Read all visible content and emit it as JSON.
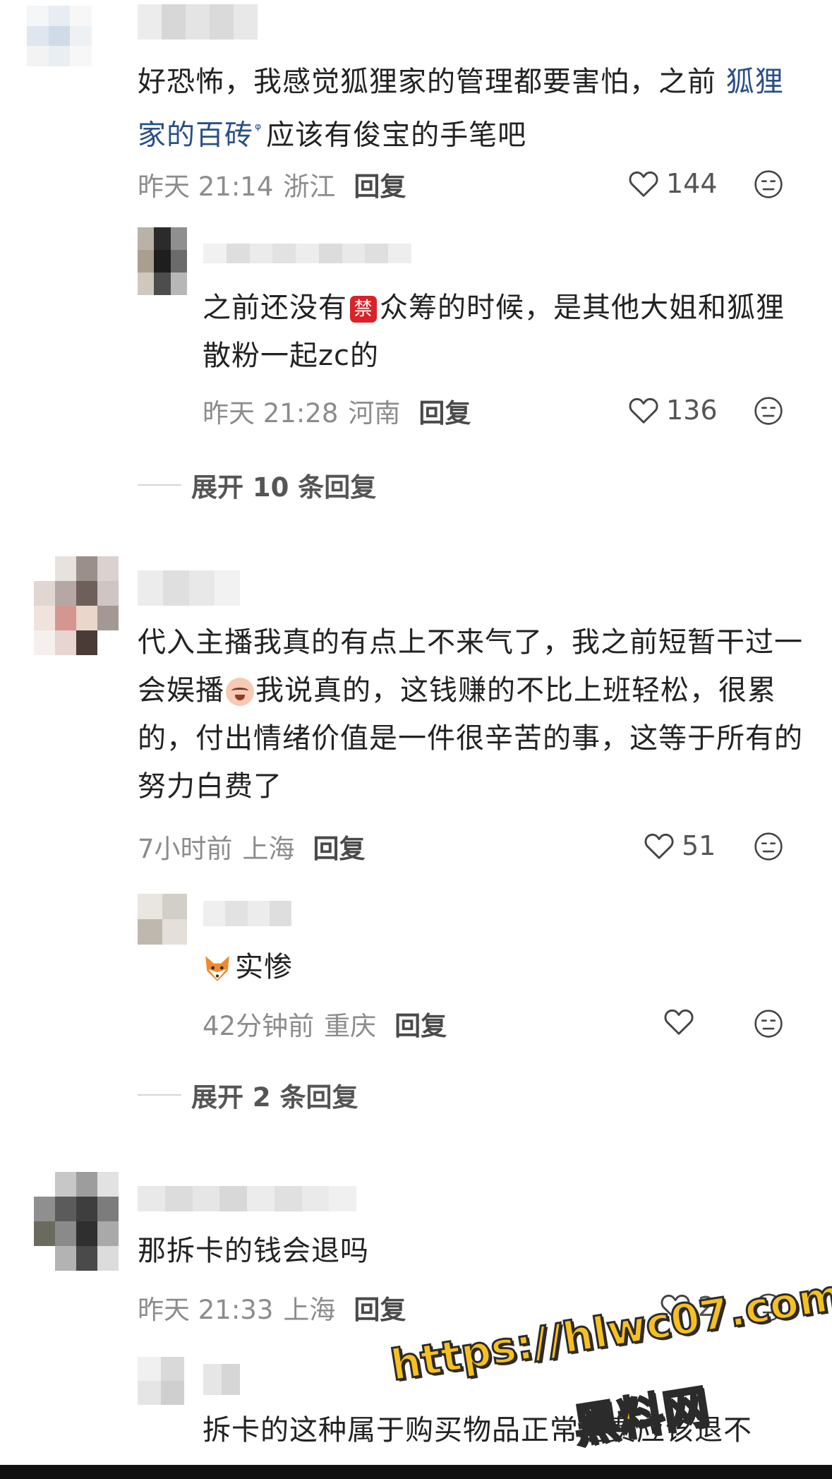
{
  "comments": [
    {
      "text_pre": "好恐怖，我感觉狐狸家的管理都要害怕，之前 ",
      "link": "狐狸家的百砖",
      "text_post": "应该有俊宝的手笔吧",
      "time": "昨天 21:14",
      "location": "浙江",
      "reply": "回复",
      "likes": "144"
    },
    {
      "text_pre": "之前还没有",
      "emoji": "禁",
      "text_post": "众筹的时候，是其他大姐和狐狸散粉一起zc的",
      "time": "昨天 21:28",
      "location": "河南",
      "reply": "回复",
      "likes": "136"
    },
    {
      "text_pre": "代入主播我真的有点上不来气了，我之前短暂干过一会娱播",
      "text_post": "我说真的，这钱赚的不比上班轻松，很累的，付出情绪价值是一件很辛苦的事，这等于所有的努力白费了",
      "time": "7小时前",
      "location": "上海",
      "reply": "回复",
      "likes": "51"
    },
    {
      "text": "实惨",
      "time": "42分钟前",
      "location": "重庆",
      "reply": "回复",
      "likes": ""
    },
    {
      "text": "那拆卡的钱会退吗",
      "time": "昨天 21:33",
      "location": "上海",
      "reply": "回复",
      "likes": "2"
    },
    {
      "text": "拆卡的这种属于购买物品正常消费应该退不"
    }
  ],
  "expand": [
    {
      "label": "展开 10 条回复"
    },
    {
      "label": "展开 2 条回复"
    }
  ],
  "watermark": {
    "url": "https://hlwc07.com",
    "brand": "黑料网"
  },
  "colors": {
    "link": "#2a4f89",
    "meta": "#8c8c8c",
    "watermark": "#f7c021"
  }
}
